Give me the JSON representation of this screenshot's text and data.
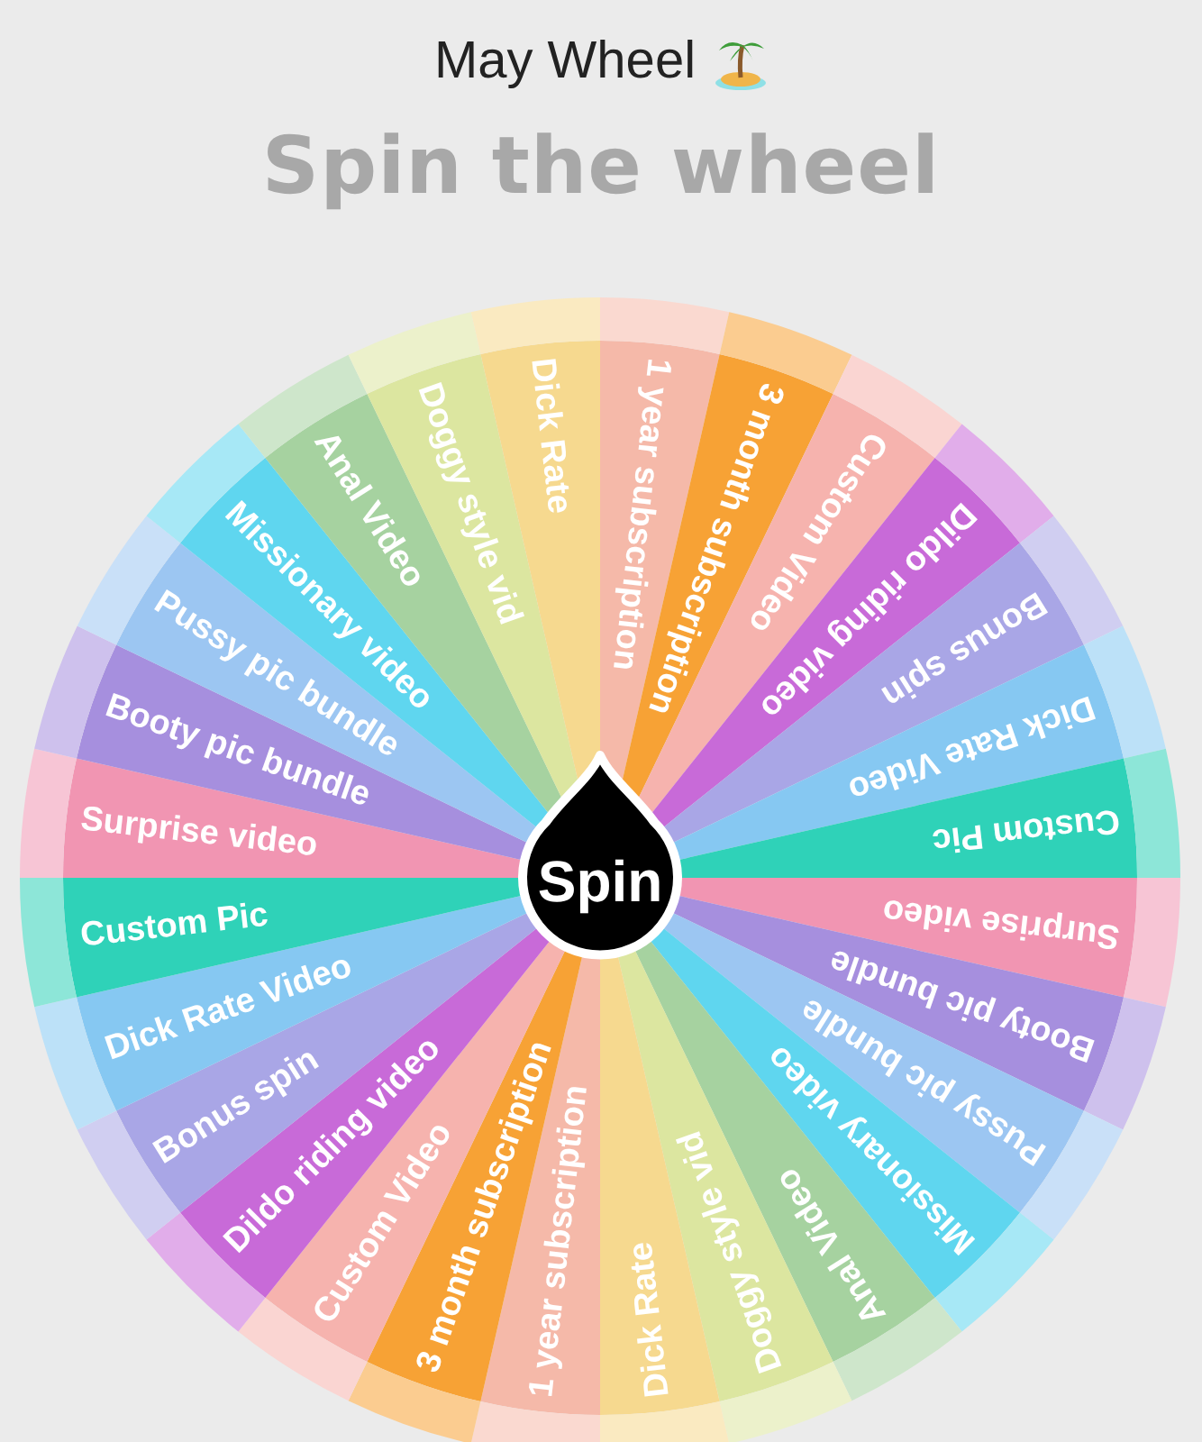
{
  "header": {
    "title": "May Wheel",
    "heading": "Spin the wheel"
  },
  "wheel": {
    "spin_button": "Spin",
    "segments": [
      {
        "label": "1 year subscription",
        "color": "#f5b9a9"
      },
      {
        "label": "3 month subscription",
        "color": "#f7a235"
      },
      {
        "label": "Custom Video",
        "color": "#f6b3ae"
      },
      {
        "label": "Dildo riding video",
        "color": "#c86ad8"
      },
      {
        "label": "Bonus spin",
        "color": "#a9a6e6"
      },
      {
        "label": "Dick Rate Video",
        "color": "#86c8f2"
      },
      {
        "label": "Custom Pic",
        "color": "#2fd2b8"
      },
      {
        "label": "Surprise video",
        "color": "#f195b2"
      },
      {
        "label": "Booty pic bundle",
        "color": "#a68fde"
      },
      {
        "label": "Pussy pic bundle",
        "color": "#9cc6f2"
      },
      {
        "label": "Missionary video",
        "color": "#5fd6ef"
      },
      {
        "label": "Anal Video",
        "color": "#a6d2a0"
      },
      {
        "label": "Doggy style vid",
        "color": "#dce6a0"
      },
      {
        "label": "Dick Rate",
        "color": "#f6d98f"
      },
      {
        "label": "1 year subscription",
        "color": "#f5b9a9"
      },
      {
        "label": "3 month subscription",
        "color": "#f7a235"
      },
      {
        "label": "Custom Video",
        "color": "#f6b3ae"
      },
      {
        "label": "Dildo riding video",
        "color": "#c86ad8"
      },
      {
        "label": "Bonus spin",
        "color": "#a9a6e6"
      },
      {
        "label": "Dick Rate Video",
        "color": "#86c8f2"
      },
      {
        "label": "Custom Pic",
        "color": "#2fd2b8"
      },
      {
        "label": "Surprise video",
        "color": "#f195b2"
      },
      {
        "label": "Booty pic bundle",
        "color": "#a68fde"
      },
      {
        "label": "Pussy pic bundle",
        "color": "#9cc6f2"
      },
      {
        "label": "Missionary video",
        "color": "#5fd6ef"
      },
      {
        "label": "Anal Video",
        "color": "#a6d2a0"
      },
      {
        "label": "Doggy style vid",
        "color": "#dce6a0"
      },
      {
        "label": "Dick Rate",
        "color": "#f6d98f"
      }
    ]
  }
}
